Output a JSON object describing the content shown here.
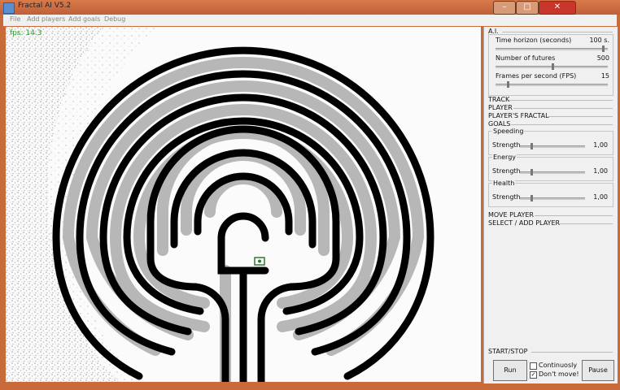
{
  "window": {
    "title": "Fractal AI V5.2"
  },
  "menu": [
    "File",
    "Add players",
    "Add goals",
    "Debug"
  ],
  "canvas": {
    "fps": "fps: 14.3"
  },
  "ai": {
    "heading": "A.I.",
    "sliders": [
      {
        "label": "Time horizon (seconds)",
        "value": "100 s.",
        "level": 0.95
      },
      {
        "label": "Number of futures",
        "value": "500",
        "level": 0.5
      },
      {
        "label": "Frames per second (FPS)",
        "value": "15",
        "level": 0.1
      }
    ]
  },
  "sections": [
    "TRACK",
    "PLAYER",
    "PLAYER'S FRACTAL",
    "GOALS"
  ],
  "goals": [
    {
      "name": "Speeding",
      "strength_label": "Strength",
      "value": "1,00",
      "level": 0.17
    },
    {
      "name": "Energy",
      "strength_label": "Strength",
      "value": "1,00",
      "level": 0.17
    },
    {
      "name": "Health",
      "strength_label": "Strength",
      "value": "1,00",
      "level": 0.17
    }
  ],
  "lower_sections": [
    "MOVE PLAYER",
    "SELECT / ADD PLAYER"
  ],
  "start_stop": {
    "heading": "START/STOP",
    "run": "Run",
    "continuously": "Continuosly",
    "continuously_checked": false,
    "dont_move": "Don't move!",
    "dont_move_checked": true,
    "pause": "Pause"
  },
  "colors": {
    "title_bar": "#c96a3a",
    "close_button": "#c8352a",
    "fps_text": "#2d9a2d",
    "maze_wall": "#000000",
    "trail": "#9a9a9a"
  }
}
